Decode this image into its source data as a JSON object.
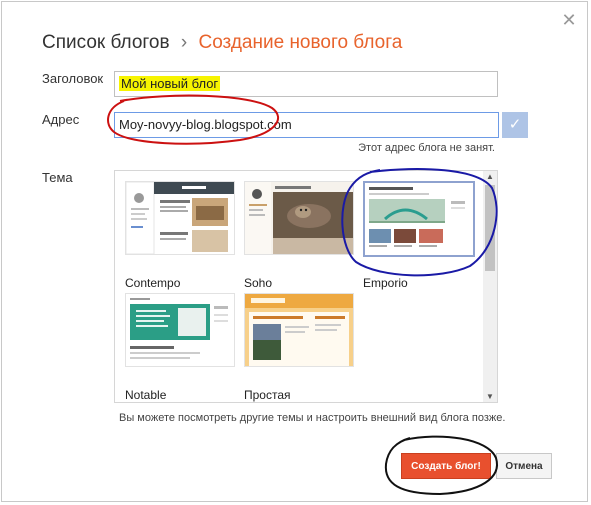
{
  "dialog": {
    "breadcrumb": {
      "parent": "Список блогов",
      "separator": "›",
      "current": "Создание нового блога"
    },
    "close_icon": "close-icon"
  },
  "form": {
    "title_label": "Заголовок",
    "title_value": "Мой новый блог",
    "address_label": "Адрес",
    "address_value": "Moy-novyy-blog.blogspot.com",
    "address_status": "Этот адрес блога не занят.",
    "check_icon": "checkmark-icon"
  },
  "themes": {
    "label": "Тема",
    "items": [
      {
        "name": "Contempo"
      },
      {
        "name": "Soho"
      },
      {
        "name": "Emporio",
        "selected": true
      },
      {
        "name": "Notable"
      },
      {
        "name": "Простая"
      }
    ],
    "hint": "Вы можете посмотреть другие темы и настроить внешний вид блога позже."
  },
  "actions": {
    "create_label": "Создать блог!",
    "cancel_label": "Отмена"
  },
  "colors": {
    "accent": "#e8632c",
    "create_button": "#e8502e",
    "title_highlight": "#f7f400",
    "annotation_red": "#cc1111",
    "annotation_blue": "#1a1aa6",
    "annotation_black": "#111111"
  }
}
